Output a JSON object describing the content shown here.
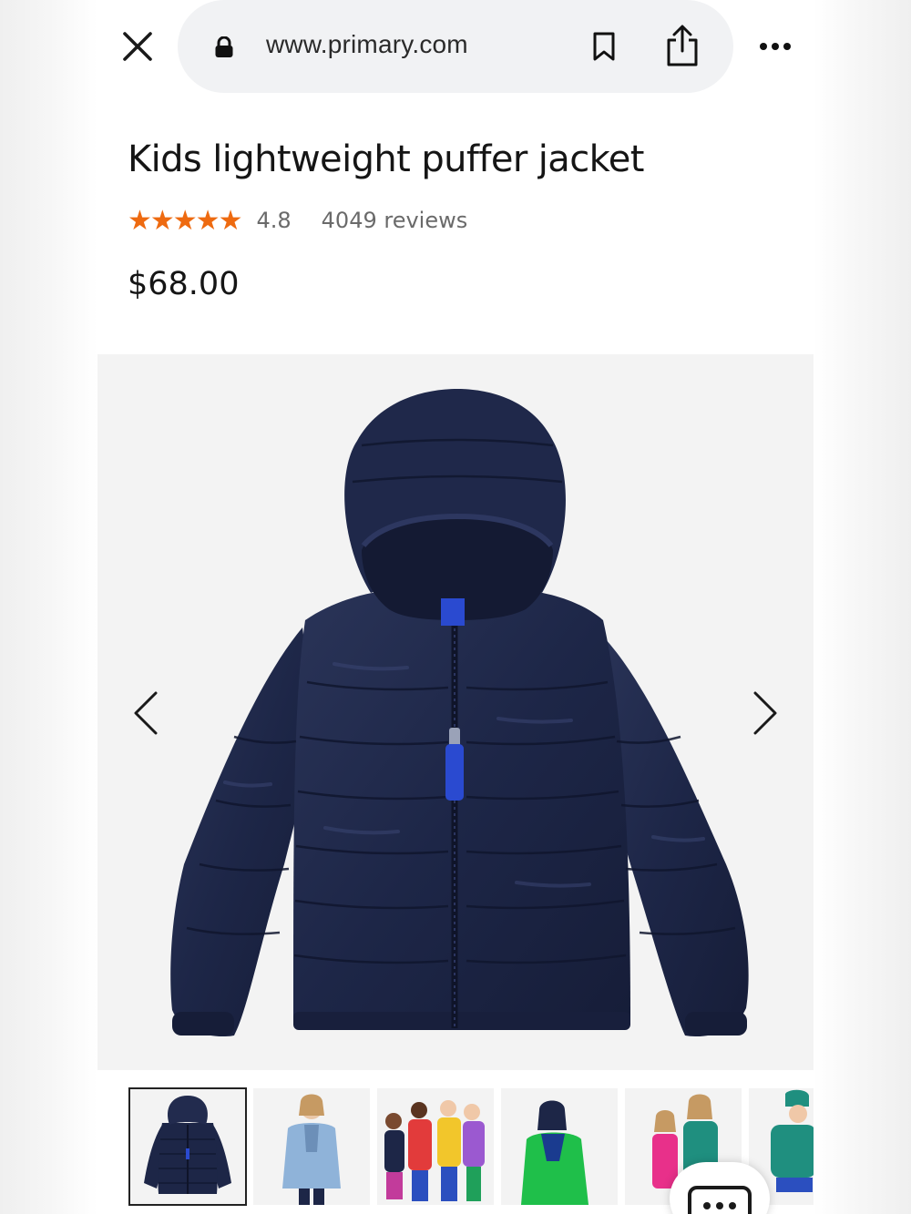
{
  "browser": {
    "url": "www.primary.com",
    "icons": [
      "close-icon",
      "lock-icon",
      "bookmark-icon",
      "share-icon",
      "more-icon"
    ]
  },
  "product": {
    "title": "Kids lightweight puffer jacket",
    "rating": {
      "stars": "★★★★★",
      "value": "4.8",
      "reviews": "4049 reviews",
      "star_color": "#ee6a10"
    },
    "price": "$68.00"
  },
  "gallery": {
    "main_image": "navy puffer jacket with hood",
    "jacket_color": "#1d2647",
    "zipper_pull_color": "#2a4ad0",
    "thumbnails": [
      {
        "subject": "navy jacket",
        "selected": true
      },
      {
        "subject": "child in light blue jacket",
        "selected": false
      },
      {
        "subject": "group of kids in colorful jackets",
        "selected": false
      },
      {
        "subject": "child in green jacket",
        "selected": false
      },
      {
        "subject": "two girls in pink and teal jackets",
        "selected": false
      },
      {
        "subject": "child in teal jacket",
        "selected": false
      }
    ]
  }
}
